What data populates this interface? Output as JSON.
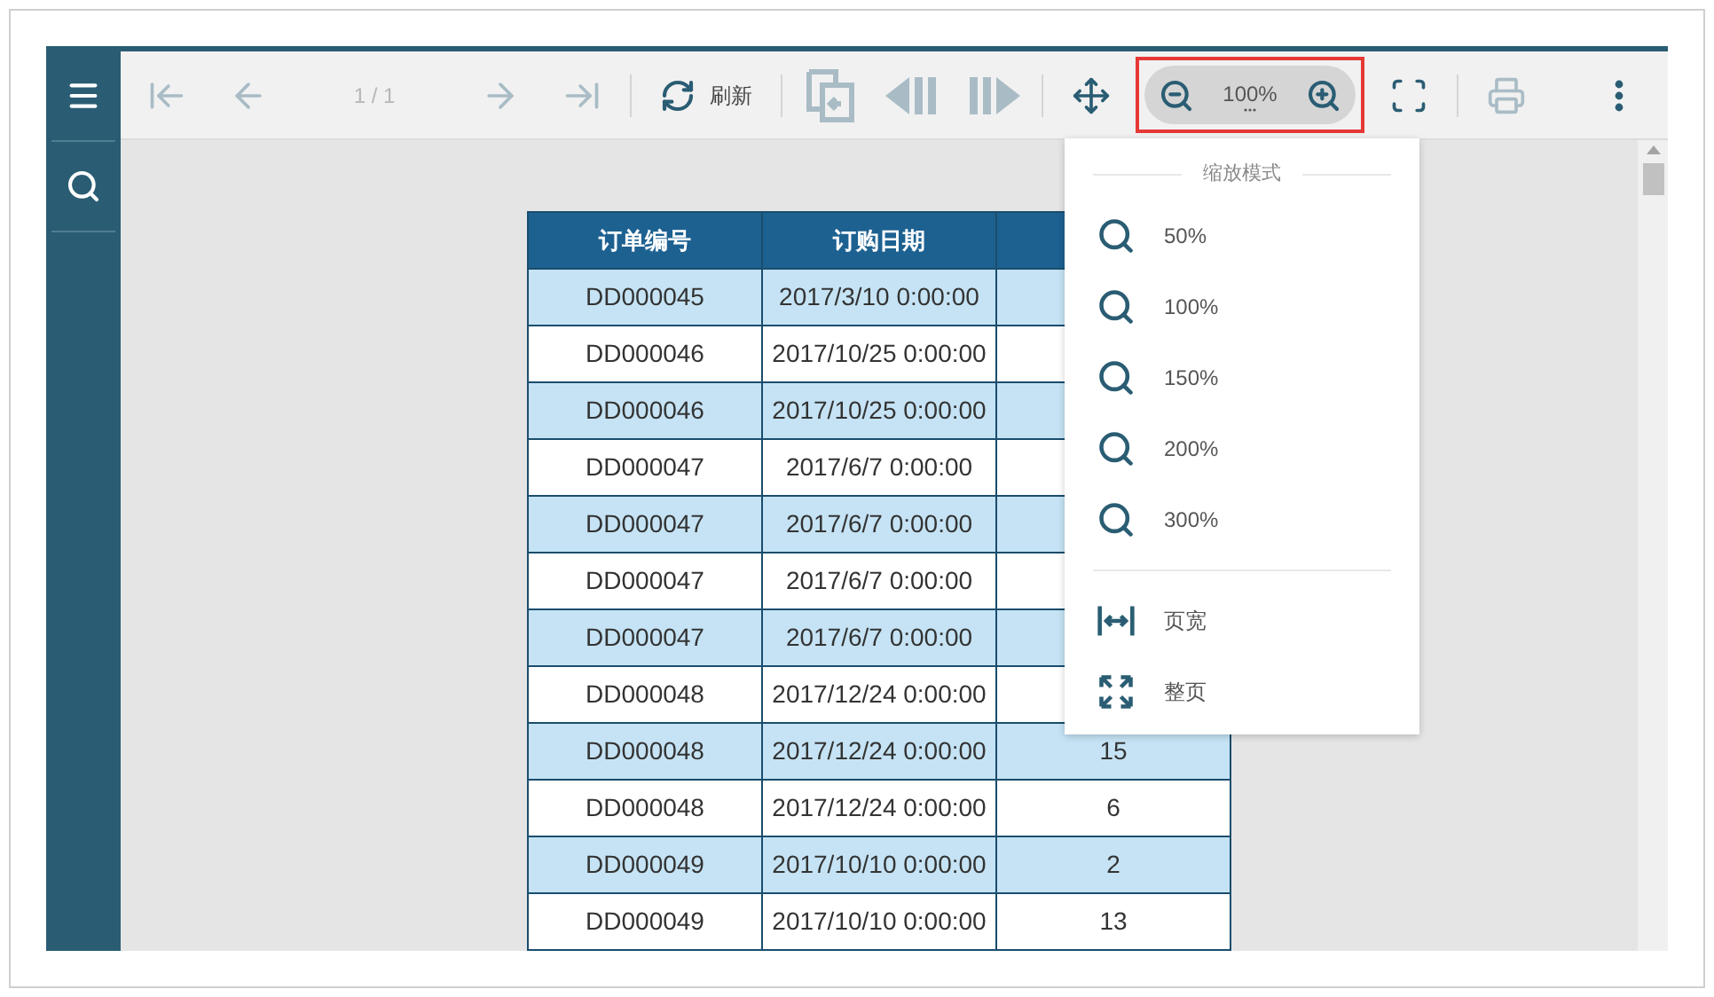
{
  "sidebar": {
    "items": [
      {
        "kind": "menu"
      },
      {
        "kind": "search"
      }
    ]
  },
  "toolbar": [
    {
      "kind": "first",
      "disabled": true
    },
    {
      "kind": "prev",
      "disabled": true
    },
    {
      "kind": "page",
      "text": "1 / 1",
      "disabled": true
    },
    {
      "kind": "next",
      "disabled": true
    },
    {
      "kind": "last",
      "disabled": true
    },
    {
      "kind": "separator"
    },
    {
      "kind": "refresh",
      "label": "刷新",
      "disabled": false
    },
    {
      "kind": "separator"
    },
    {
      "kind": "export",
      "disabled": true
    },
    {
      "kind": "prev_section",
      "disabled": true
    },
    {
      "kind": "next_section",
      "disabled": true
    },
    {
      "kind": "separator"
    },
    {
      "kind": "move",
      "disabled": false
    },
    {
      "kind": "zoom",
      "value": "100%",
      "highlighted": true,
      "expanded": true
    },
    {
      "kind": "fullscreen",
      "disabled": false
    },
    {
      "kind": "separator"
    },
    {
      "kind": "print",
      "disabled": true
    },
    {
      "kind": "spacer"
    },
    {
      "kind": "more",
      "disabled": false
    }
  ],
  "zoom_menu": {
    "title": "缩放模式",
    "items": [
      {
        "kind": "zoom",
        "label": "50%"
      },
      {
        "kind": "zoom",
        "label": "100%"
      },
      {
        "kind": "zoom",
        "label": "150%"
      },
      {
        "kind": "zoom",
        "label": "200%"
      },
      {
        "kind": "zoom",
        "label": "300%"
      },
      {
        "kind": "divider"
      },
      {
        "kind": "page_width",
        "label": "页宽"
      },
      {
        "kind": "whole_page",
        "label": "整页"
      }
    ]
  },
  "table": {
    "columns": [
      "订单编号",
      "订购日期"
    ],
    "rows": [
      {
        "order_no": "DD000045",
        "date": "2017/3/10 0:00:00"
      },
      {
        "order_no": "DD000046",
        "date": "2017/10/25 0:00:00"
      },
      {
        "order_no": "DD000046",
        "date": "2017/10/25 0:00:00"
      },
      {
        "order_no": "DD000047",
        "date": "2017/6/7 0:00:00"
      },
      {
        "order_no": "DD000047",
        "date": "2017/6/7 0:00:00"
      },
      {
        "order_no": "DD000047",
        "date": "2017/6/7 0:00:00"
      },
      {
        "order_no": "DD000047",
        "date": "2017/6/7 0:00:00"
      },
      {
        "order_no": "DD000048",
        "date": "2017/12/24 0:00:00"
      },
      {
        "order_no": "DD000048",
        "date": "2017/12/24 0:00:00",
        "column_3": "15"
      },
      {
        "order_no": "DD000048",
        "date": "2017/12/24 0:00:00",
        "column_3": "6"
      },
      {
        "order_no": "DD000049",
        "date": "2017/10/10 0:00:00",
        "column_3": "2"
      },
      {
        "order_no": "DD000049",
        "date": "2017/10/10 0:00:00",
        "column_3": "13"
      }
    ]
  }
}
